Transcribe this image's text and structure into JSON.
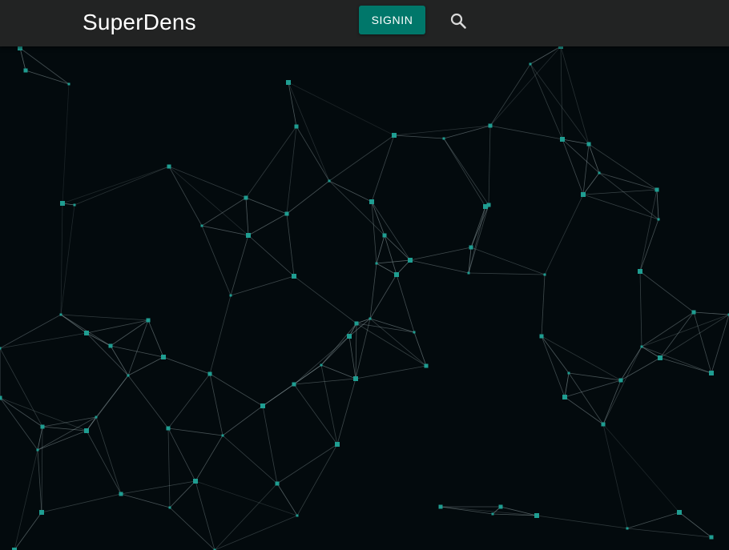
{
  "header": {
    "brand": "SuperDens",
    "signin_label": "SIGNIN",
    "search_icon": "search-icon"
  },
  "colors": {
    "appbar": "#222323",
    "accent": "#00776a",
    "background": "#030a0d",
    "node": "#1f9d91",
    "link": "#9fb0b3"
  }
}
